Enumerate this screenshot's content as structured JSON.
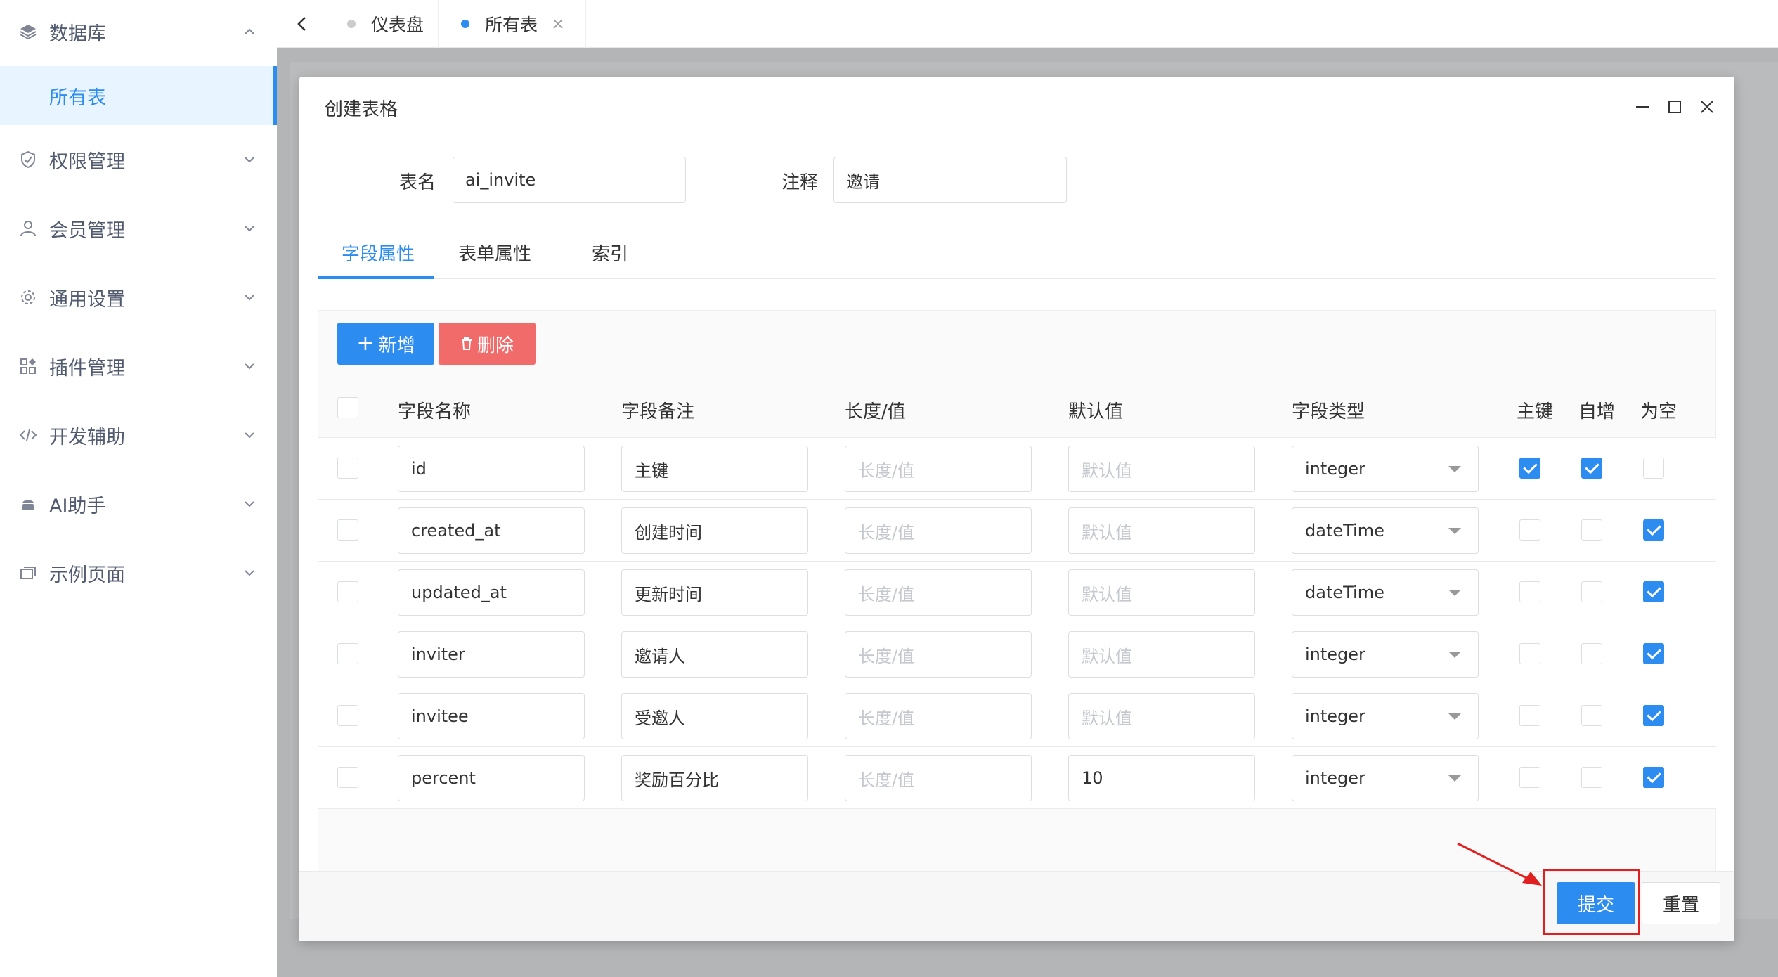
{
  "colors": {
    "primary": "#2d8cf0",
    "danger": "#f26b6b",
    "annotation": "#e02020"
  },
  "sidebar": {
    "items": [
      {
        "label": "数据库",
        "icon": "layers-icon",
        "expanded": true
      },
      {
        "label": "权限管理",
        "icon": "shield-icon"
      },
      {
        "label": "会员管理",
        "icon": "user-icon"
      },
      {
        "label": "通用设置",
        "icon": "gear-icon"
      },
      {
        "label": "插件管理",
        "icon": "plugin-grid-icon"
      },
      {
        "label": "开发辅助",
        "icon": "code-icon"
      },
      {
        "label": "AI助手",
        "icon": "android-icon"
      },
      {
        "label": "示例页面",
        "icon": "pages-icon"
      }
    ],
    "active_sub": "所有表"
  },
  "tabs_bar": {
    "tabs": [
      {
        "label": "仪表盘",
        "active": false
      },
      {
        "label": "所有表",
        "active": true
      }
    ]
  },
  "modal": {
    "title": "创建表格",
    "table_name_label": "表名",
    "table_name_value": "ai_invite",
    "comment_label": "注释",
    "comment_value": "邀请",
    "tabs": [
      "字段属性",
      "表单属性",
      "索引"
    ],
    "add_button": "新增",
    "delete_button": "删除",
    "columns": [
      "字段名称",
      "字段备注",
      "长度/值",
      "默认值",
      "字段类型",
      "主键",
      "自增",
      "为空"
    ],
    "length_placeholder": "长度/值",
    "default_placeholder": "默认值",
    "rows": [
      {
        "name": "id",
        "comment": "主键",
        "length": "",
        "default": "",
        "type": "integer",
        "pk": true,
        "ai": true,
        "nullable": false
      },
      {
        "name": "created_at",
        "comment": "创建时间",
        "length": "",
        "default": "",
        "type": "dateTime",
        "pk": false,
        "ai": false,
        "nullable": true
      },
      {
        "name": "updated_at",
        "comment": "更新时间",
        "length": "",
        "default": "",
        "type": "dateTime",
        "pk": false,
        "ai": false,
        "nullable": true
      },
      {
        "name": "inviter",
        "comment": "邀请人",
        "length": "",
        "default": "",
        "type": "integer",
        "pk": false,
        "ai": false,
        "nullable": true
      },
      {
        "name": "invitee",
        "comment": "受邀人",
        "length": "",
        "default": "",
        "type": "integer",
        "pk": false,
        "ai": false,
        "nullable": true
      },
      {
        "name": "percent",
        "comment": "奖励百分比",
        "length": "",
        "default": "10",
        "type": "integer",
        "pk": false,
        "ai": false,
        "nullable": true
      }
    ],
    "submit_button": "提交",
    "reset_button": "重置"
  }
}
